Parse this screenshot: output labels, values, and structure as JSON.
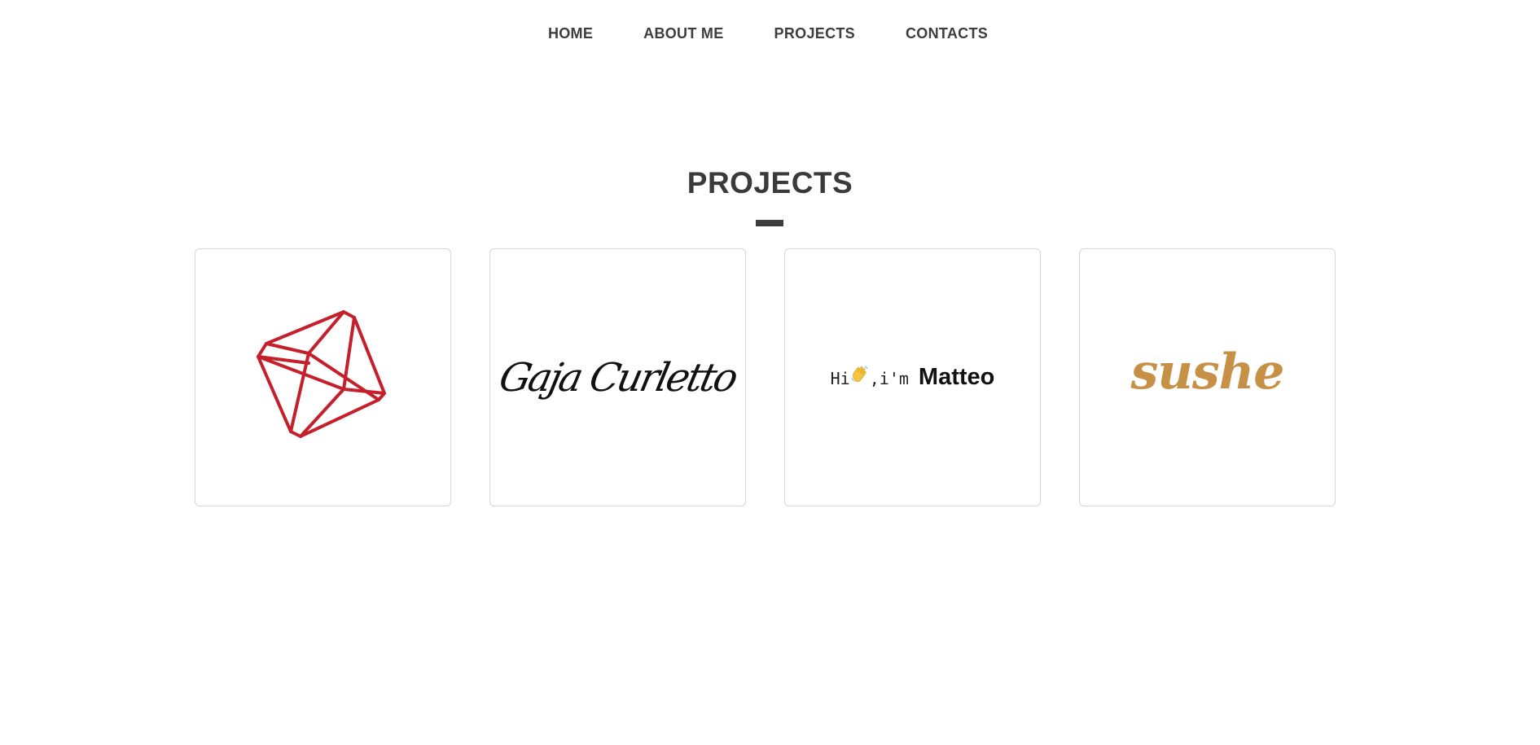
{
  "nav": {
    "items": [
      {
        "label": "HOME"
      },
      {
        "label": "ABOUT ME"
      },
      {
        "label": "PROJECTS"
      },
      {
        "label": "CONTACTS"
      }
    ]
  },
  "projects": {
    "title": "PROJECTS",
    "cards": [
      {
        "logo": "red-geometric-gem-logo",
        "color": "#c41f2b"
      },
      {
        "logo_text": "Gaja Curletto"
      },
      {
        "prefix": "Hi",
        "suffix": ",i'm",
        "name": "Matteo",
        "emoji": "waving-hand-icon"
      },
      {
        "logo_text": "sushe",
        "color": "#c69046"
      }
    ]
  }
}
